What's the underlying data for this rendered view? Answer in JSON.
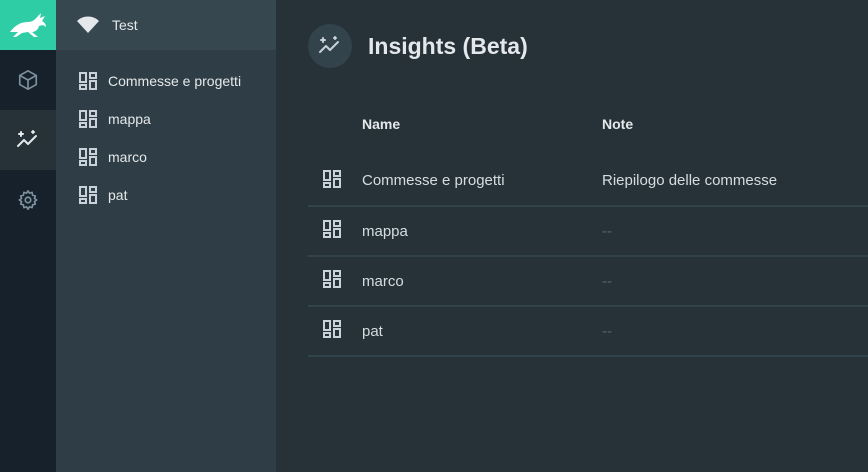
{
  "nav": {
    "header_label": "Test",
    "items": [
      {
        "label": "Commesse e progetti"
      },
      {
        "label": "mappa"
      },
      {
        "label": "marco"
      },
      {
        "label": "pat"
      }
    ]
  },
  "modules": [
    "box-icon",
    "insights-icon",
    "gear-icon"
  ],
  "main": {
    "title": "Insights (Beta)",
    "columns": {
      "name": "Name",
      "note": "Note"
    },
    "rows": [
      {
        "name": "Commesse e progetti",
        "note": "Riepilogo delle commesse"
      },
      {
        "name": "mappa",
        "note": "--"
      },
      {
        "name": "marco",
        "note": "--"
      },
      {
        "name": "pat",
        "note": "--"
      }
    ]
  },
  "colors": {
    "brand": "#2ecda6",
    "background": "#263238",
    "sidebar": "#2f3e46"
  }
}
